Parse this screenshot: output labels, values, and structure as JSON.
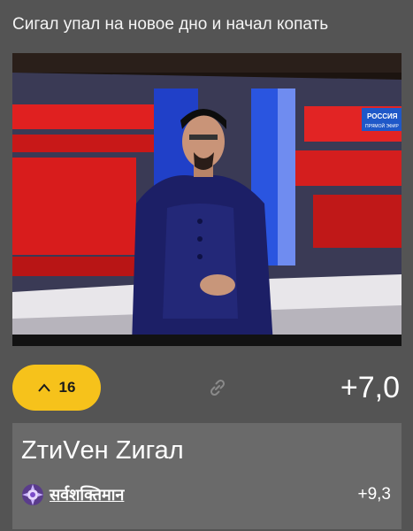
{
  "post": {
    "title": "Сигал упал на новое дно и начал копать",
    "upvote_count": "16",
    "score": "+7,0",
    "photo": {
      "channel_badge_line1": "РОССИЯ",
      "channel_badge_line2": "ПРЯМОЙ ЭФИР"
    }
  },
  "top_comment": {
    "text": "ZтиVен Zигал",
    "author": "सर्वशक्तिमान",
    "score": "+9,3"
  },
  "colors": {
    "background": "#545454",
    "comment_bg": "#6a6a6a",
    "upvote_accent": "#f6c21b"
  },
  "icons": {
    "upvote": "chevron-up-icon",
    "share": "link-icon",
    "author": "avatar-icon"
  }
}
